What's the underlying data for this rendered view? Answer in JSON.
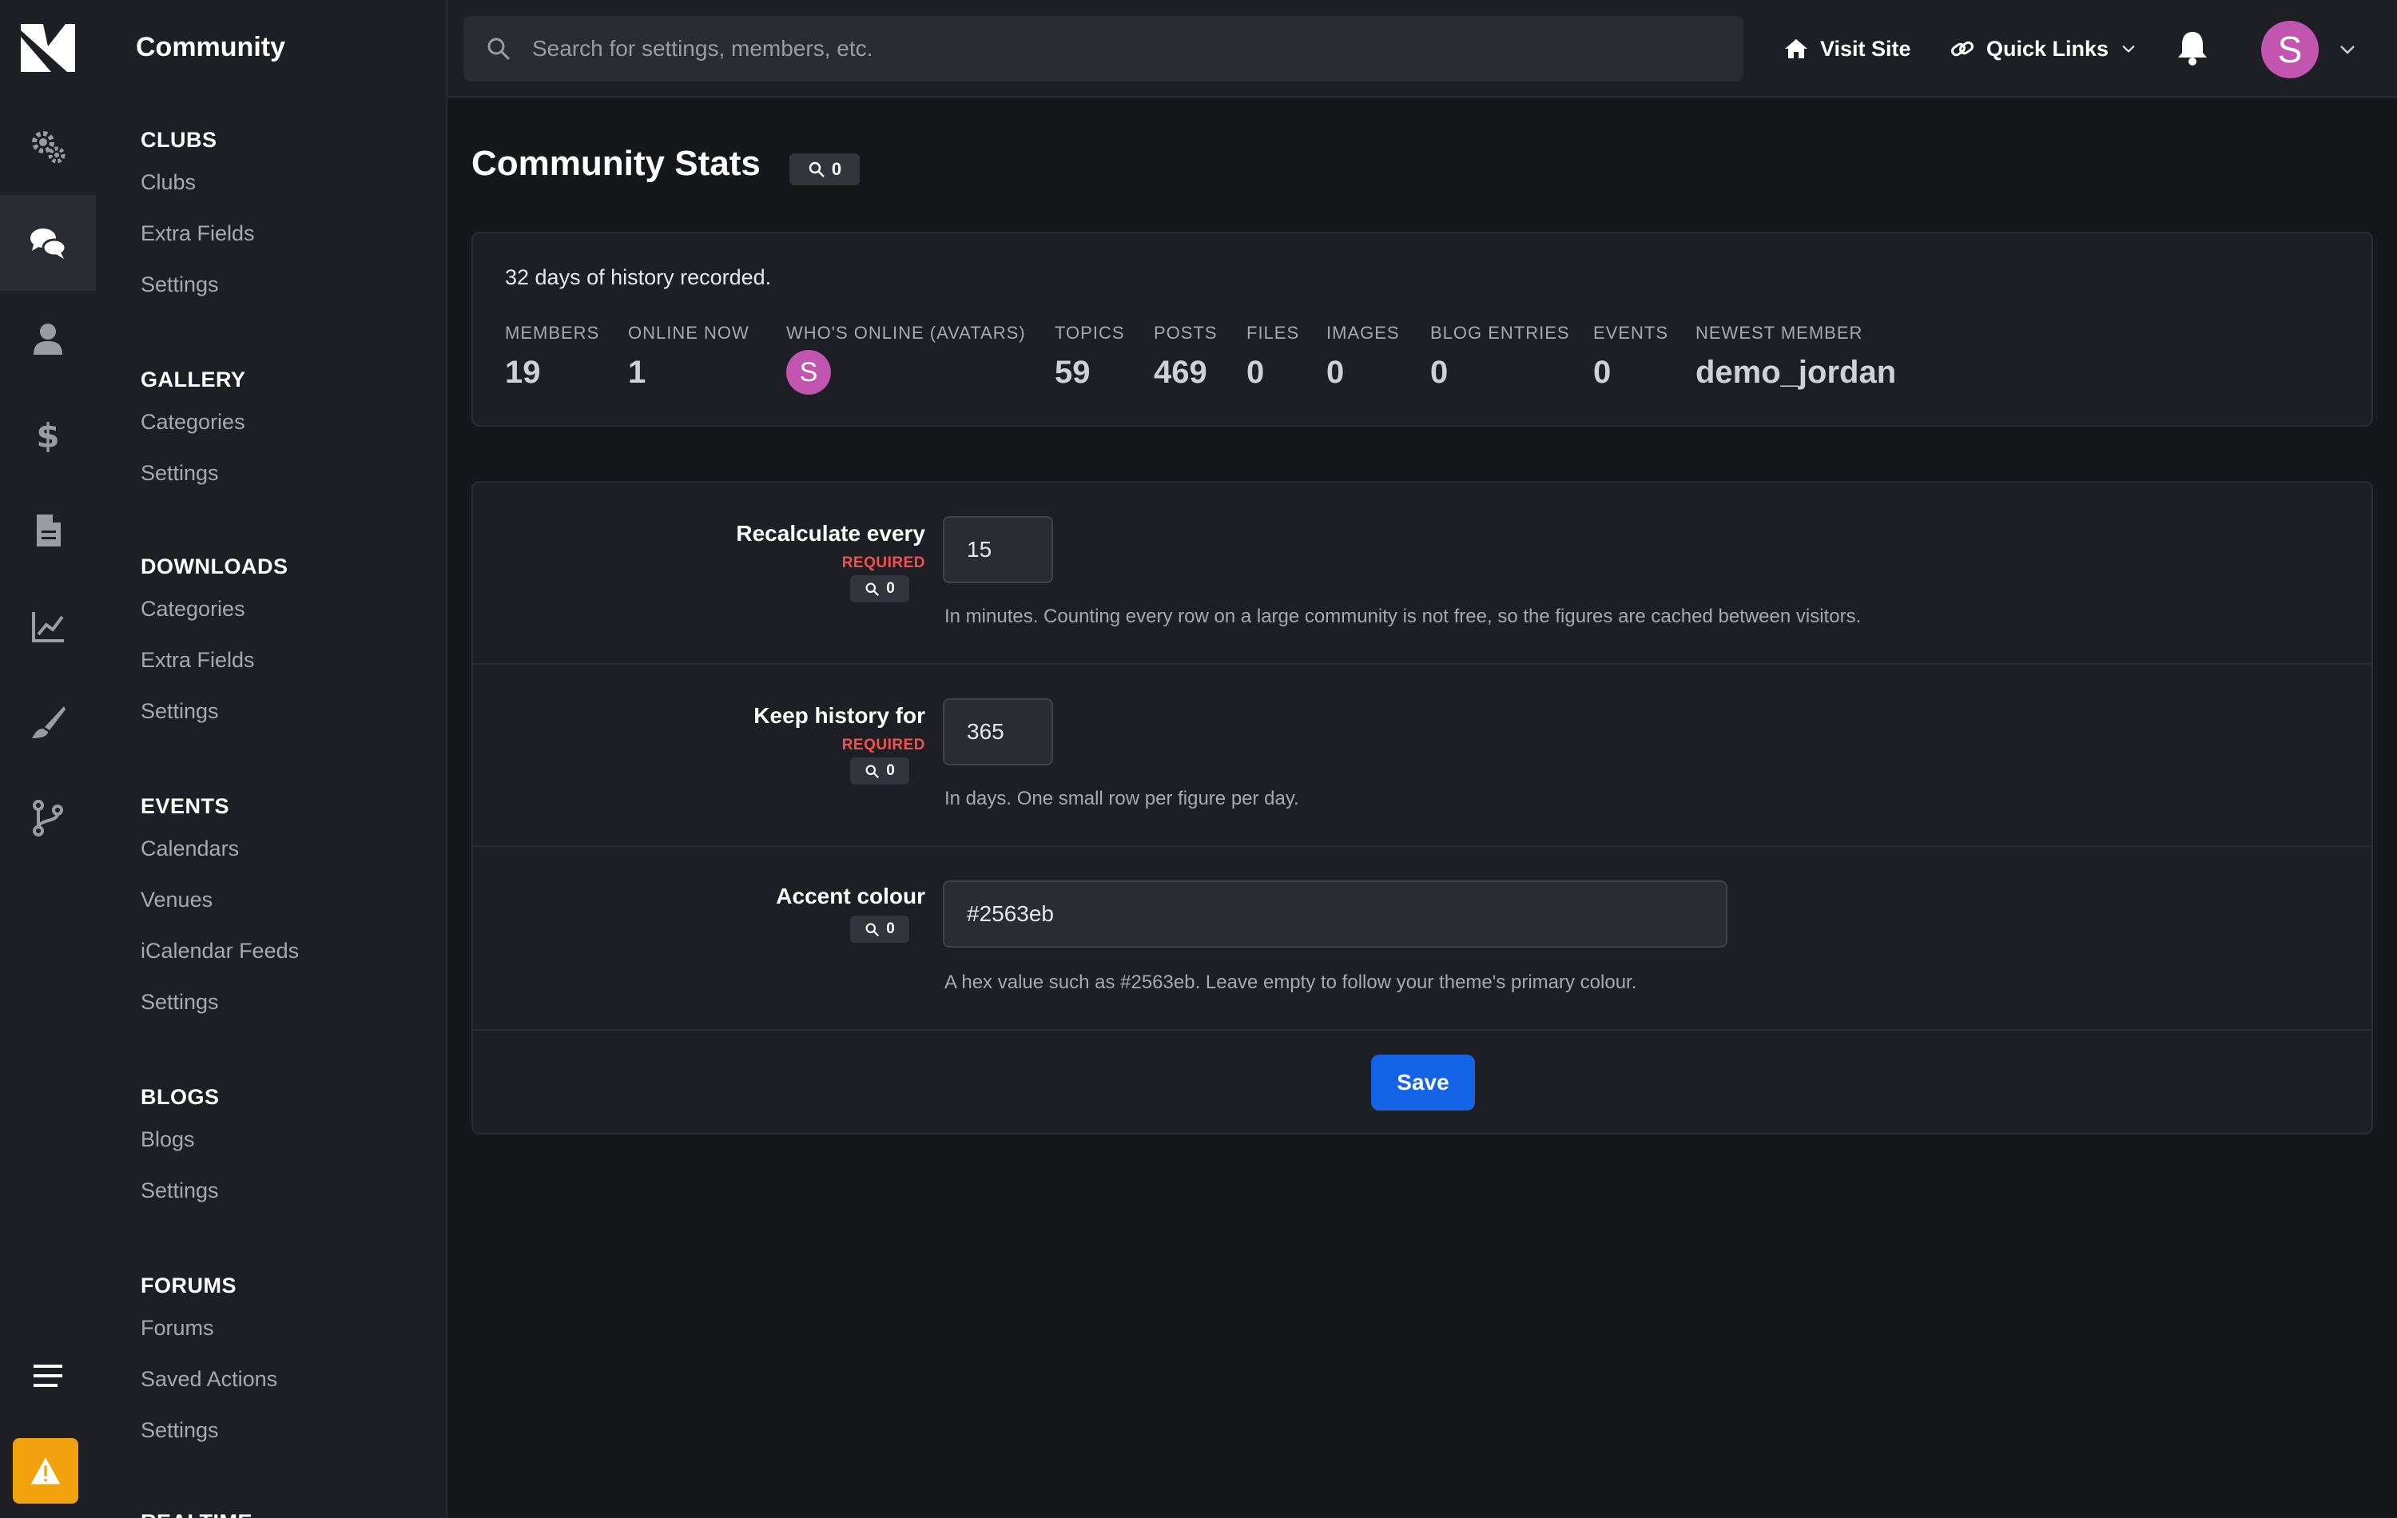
{
  "colors": {
    "accent": "#1463e5",
    "avatar": "#c155b0",
    "required": "#f05252",
    "alert": "#f2a20c"
  },
  "rail": {
    "items": [
      {
        "icon": "gears-icon"
      },
      {
        "icon": "chat-bubbles-icon",
        "active": true
      },
      {
        "icon": "user-icon"
      },
      {
        "icon": "dollar-icon"
      },
      {
        "icon": "document-icon"
      },
      {
        "icon": "line-chart-icon"
      },
      {
        "icon": "brush-icon"
      },
      {
        "icon": "code-branch-icon"
      }
    ],
    "bottom": [
      "menu-icon",
      "warning-icon"
    ]
  },
  "subnav": {
    "title": "Community",
    "groups": [
      {
        "heading": "CLUBS",
        "items": [
          "Clubs",
          "Extra Fields",
          "Settings"
        ]
      },
      {
        "heading": "GALLERY",
        "items": [
          "Categories",
          "Settings"
        ]
      },
      {
        "heading": "DOWNLOADS",
        "items": [
          "Categories",
          "Extra Fields",
          "Settings"
        ]
      },
      {
        "heading": "EVENTS",
        "items": [
          "Calendars",
          "Venues",
          "iCalendar Feeds",
          "Settings"
        ]
      },
      {
        "heading": "BLOGS",
        "items": [
          "Blogs",
          "Settings"
        ]
      },
      {
        "heading": "FORUMS",
        "items": [
          "Forums",
          "Saved Actions",
          "Settings"
        ]
      },
      {
        "heading": "REALTIME",
        "items": []
      }
    ]
  },
  "topbar": {
    "search_placeholder": "Search for settings, members, etc.",
    "visit_site": "Visit Site",
    "quick_links": "Quick Links",
    "user_initial": "S"
  },
  "page": {
    "title": "Community Stats",
    "search_count": "0"
  },
  "stats": {
    "history": "32 days of history recorded.",
    "members": {
      "label": "MEMBERS",
      "value": "19"
    },
    "online_now": {
      "label": "ONLINE NOW",
      "value": "1"
    },
    "whos_online": {
      "label": "WHO'S ONLINE (AVATARS)",
      "avatar_initial": "S"
    },
    "topics": {
      "label": "TOPICS",
      "value": "59"
    },
    "posts": {
      "label": "POSTS",
      "value": "469"
    },
    "files": {
      "label": "FILES",
      "value": "0"
    },
    "images": {
      "label": "IMAGES",
      "value": "0"
    },
    "blog_entries": {
      "label": "BLOG ENTRIES",
      "value": "0"
    },
    "events": {
      "label": "EVENTS",
      "value": "0"
    },
    "newest_member": {
      "label": "NEWEST MEMBER",
      "value": "demo_jordan"
    }
  },
  "form": {
    "recalc": {
      "label": "Recalculate every",
      "required": "REQUIRED",
      "count": "0",
      "value": "15",
      "help": "In minutes. Counting every row on a large community is not free, so the figures are cached between visitors."
    },
    "history": {
      "label": "Keep history for",
      "required": "REQUIRED",
      "count": "0",
      "value": "365",
      "help": "In days. One small row per figure per day."
    },
    "accent": {
      "label": "Accent colour",
      "count": "0",
      "value": "#2563eb",
      "help": "A hex value such as #2563eb. Leave empty to follow your theme's primary colour."
    },
    "save_label": "Save"
  }
}
